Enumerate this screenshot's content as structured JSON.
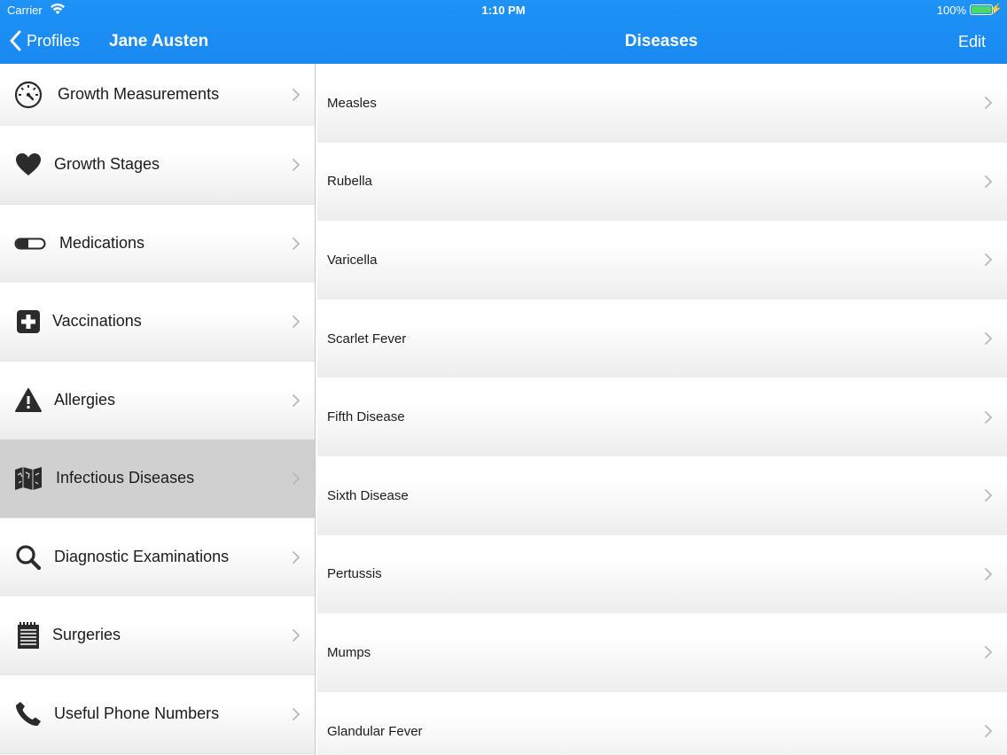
{
  "status_bar": {
    "carrier": "Carrier",
    "time": "1:10 PM",
    "battery": "100%"
  },
  "nav_left": {
    "back_label": "Profiles",
    "title": "Jane Austen"
  },
  "nav_right": {
    "title": "Diseases",
    "edit_label": "Edit"
  },
  "sidebar": {
    "items": [
      {
        "label": "Growth Measurements",
        "icon": "gauge-icon"
      },
      {
        "label": "Growth Stages",
        "icon": "heart-icon"
      },
      {
        "label": "Medications",
        "icon": "pill-icon"
      },
      {
        "label": "Vaccinations",
        "icon": "plus-box-icon"
      },
      {
        "label": "Allergies",
        "icon": "warning-icon"
      },
      {
        "label": "Infectious Diseases",
        "icon": "map-icon",
        "selected": true
      },
      {
        "label": "Diagnostic Examinations",
        "icon": "search-icon"
      },
      {
        "label": "Surgeries",
        "icon": "notepad-icon"
      },
      {
        "label": "Useful Phone Numbers",
        "icon": "phone-icon"
      }
    ]
  },
  "diseases": {
    "items": [
      {
        "label": "Measles"
      },
      {
        "label": "Rubella"
      },
      {
        "label": "Varicella"
      },
      {
        "label": "Scarlet Fever"
      },
      {
        "label": "Fifth Disease"
      },
      {
        "label": "Sixth Disease"
      },
      {
        "label": "Pertussis"
      },
      {
        "label": "Mumps"
      },
      {
        "label": "Glandular Fever"
      }
    ]
  },
  "colors": {
    "nav_blue": "#1e92f6",
    "selected_row": "#d0d0d0",
    "icon": "#2b2b2b",
    "chevron": "#b8b8b8"
  }
}
